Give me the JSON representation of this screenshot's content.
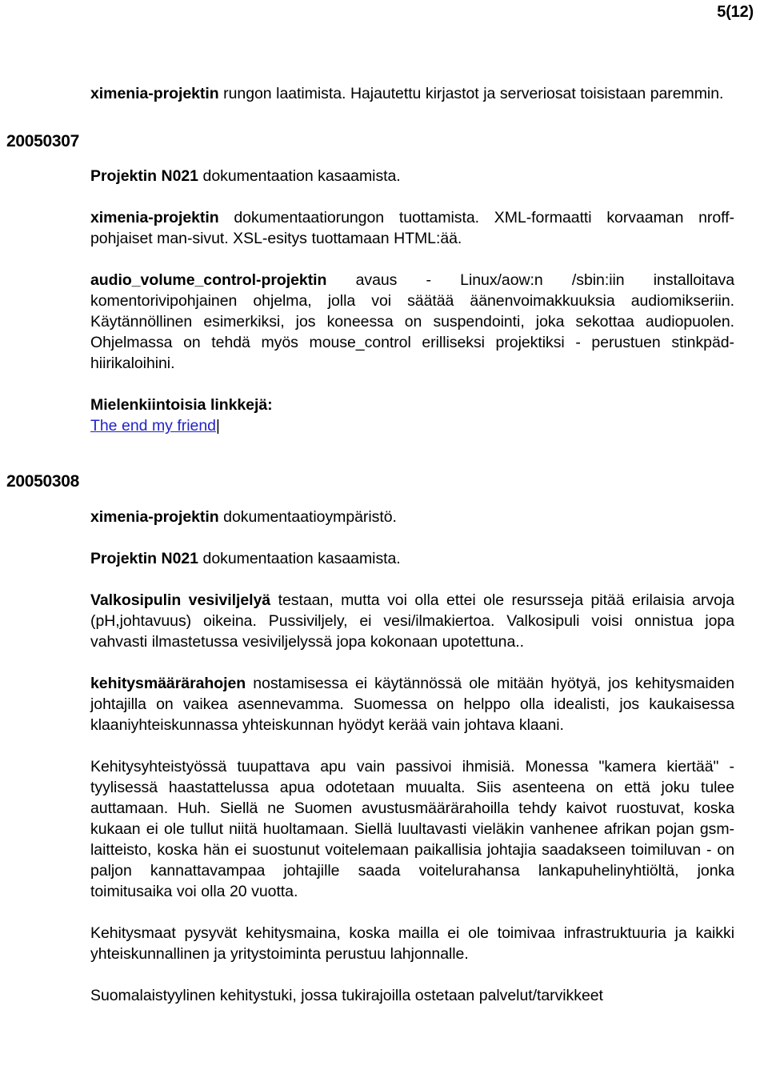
{
  "header": {
    "page_number": "5(12)"
  },
  "body": {
    "intro_paragraph": {
      "bold_lead": "ximenia-projektin",
      "rest": " rungon laatimista. Hajautettu kirjastot ja serveriosat toisistaan paremmin."
    },
    "sections": [
      {
        "date": "20050307",
        "paragraphs": [
          {
            "bold_lead": "Projektin N021",
            "rest": " dokumentaation kasaamista."
          },
          {
            "bold_lead": "ximenia-projektin",
            "rest": " dokumentaatiorungon tuottamista. XML-formaatti korvaaman nroff-pohjaiset man-sivut. XSL-esitys tuottamaan HTML:ää."
          },
          {
            "bold_lead": "audio_volume_control-projektin",
            "rest": " avaus - Linux/aow:n /sbin:iin installoitava komentorivipohjainen ohjelma, jolla voi säätää äänenvoimakkuuksia audiomikseriin. Käytännöllinen esimerkiksi, jos koneessa on suspendointi, joka sekottaa audiopuolen. Ohjelmassa on tehdä myös mouse_control erilliseksi projektiksi - perustuen stinkpäd-hiirikaloihini."
          }
        ],
        "links_block": {
          "label": "Mielenkiintoisia linkkejä:",
          "links": [
            {
              "text": "The end my friend"
            }
          ],
          "separator": "|"
        }
      },
      {
        "date": "20050308",
        "paragraphs": [
          {
            "bold_lead": "ximenia-projektin",
            "rest": " dokumentaatioympäristö."
          },
          {
            "bold_lead": "Projektin N021",
            "rest": " dokumentaation kasaamista."
          },
          {
            "bold_lead": "Valkosipulin vesiviljelyä",
            "rest": " testaan, mutta voi olla ettei ole resursseja pitää erilaisia arvoja (pH,johtavuus) oikeina. Pussiviljely, ei vesi/ilmakiertoa. Valkosipuli voisi onnistua jopa vahvasti ilmastetussa vesiviljelyssä jopa kokonaan upotettuna.."
          },
          {
            "bold_lead": "kehitysmäärärahojen",
            "rest": " nostamisessa ei käytännössä ole mitään hyötyä, jos kehitysmaiden johtajilla on vaikea asennevamma. Suomessa on helppo olla idealisti, jos kaukaisessa klaaniyhteiskunnassa yhteiskunnan hyödyt kerää vain johtava klaani."
          },
          {
            "bold_lead": "",
            "rest": "Kehitysyhteistyössä tuupattava apu vain passivoi ihmisiä. Monessa \"kamera kiertää\" -tyylisessä haastattelussa apua odotetaan muualta. Siis asenteena on että joku tulee auttamaan. Huh. Siellä ne Suomen avustusmäärärahoilla tehdy kaivot ruostuvat, koska kukaan ei ole tullut niitä huoltamaan. Siellä luultavasti vieläkin vanhenee afrikan pojan gsm-laitteisto, koska hän ei suostunut voitelemaan paikallisia johtajia saadakseen toimiluvan - on paljon kannattavampaa johtajille saada voitelurahansa lankapuhelinyhtiöltä, jonka toimitusaika voi olla 20 vuotta."
          },
          {
            "bold_lead": "",
            "rest": "Kehitysmaat pysyvät kehitysmaina, koska mailla ei ole toimivaa infrastruktuuria ja kaikki yhteiskunnallinen ja yritystoiminta perustuu lahjonnalle."
          },
          {
            "bold_lead": "",
            "rest": "Suomalaistyylinen kehitystuki, jossa tukirajoilla ostetaan palvelut/tarvikkeet"
          }
        ]
      }
    ]
  }
}
